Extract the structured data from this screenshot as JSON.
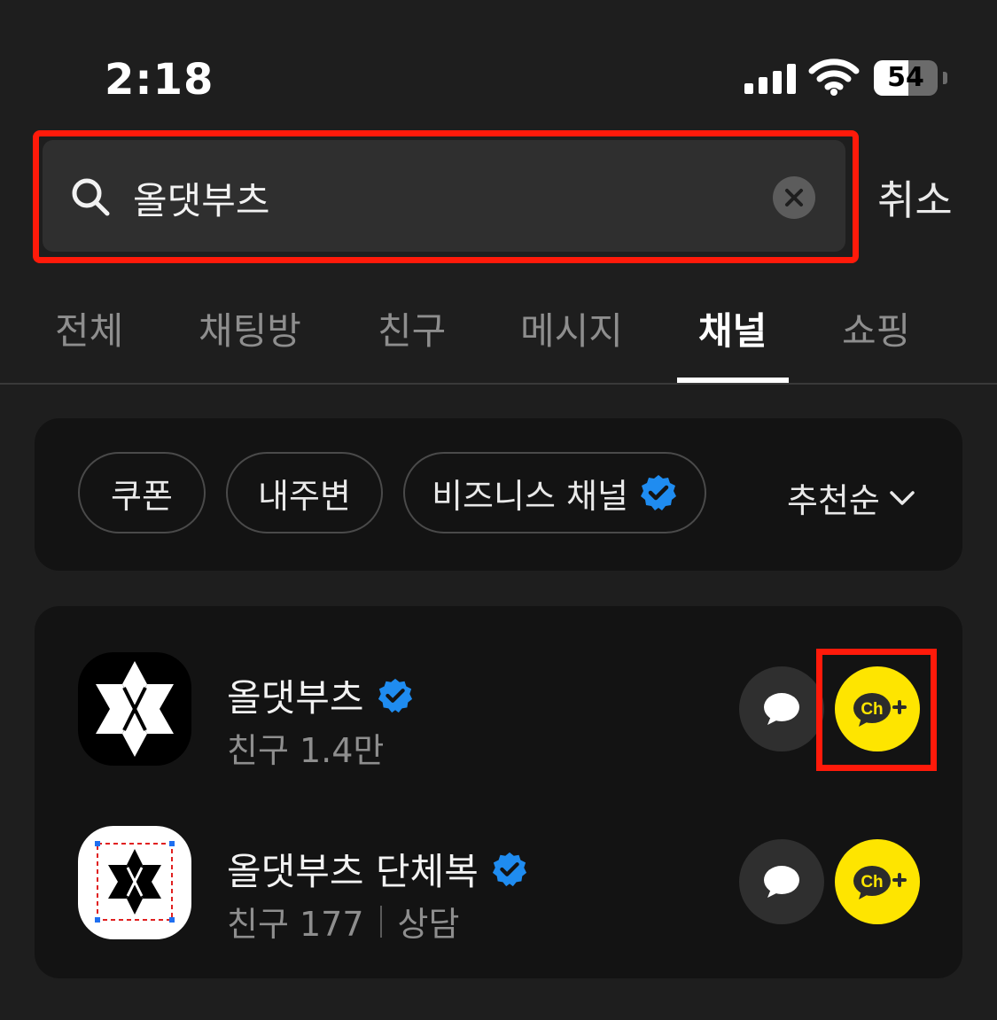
{
  "status_bar": {
    "time": "2:18",
    "battery": "54",
    "battery_level": 0.54
  },
  "search": {
    "query": "올댓부츠",
    "cancel_label": "취소"
  },
  "tabs": [
    {
      "label": "전체",
      "active": false
    },
    {
      "label": "채팅방",
      "active": false
    },
    {
      "label": "친구",
      "active": false
    },
    {
      "label": "메시지",
      "active": false
    },
    {
      "label": "채널",
      "active": true
    },
    {
      "label": "쇼핑",
      "active": false
    }
  ],
  "filters": {
    "chips": [
      "쿠폰",
      "내주변",
      "비즈니스 채널"
    ],
    "sort_label": "추천순"
  },
  "channels": [
    {
      "name": "올댓부츠",
      "friends": "친구 1.4만",
      "extra": "",
      "verified": true
    },
    {
      "name": "올댓부츠 단체복",
      "friends": "친구 177",
      "extra": "상담",
      "verified": true
    }
  ],
  "colors": {
    "highlight": "#ff1a0a",
    "verified": "#1f8cf0",
    "channel_yellow": "#fee500"
  },
  "icons": {
    "search": "search-icon",
    "clear": "clear-icon",
    "verified": "verified-badge-icon",
    "chat": "chat-bubble-icon",
    "add_channel": "channel-add-icon"
  }
}
